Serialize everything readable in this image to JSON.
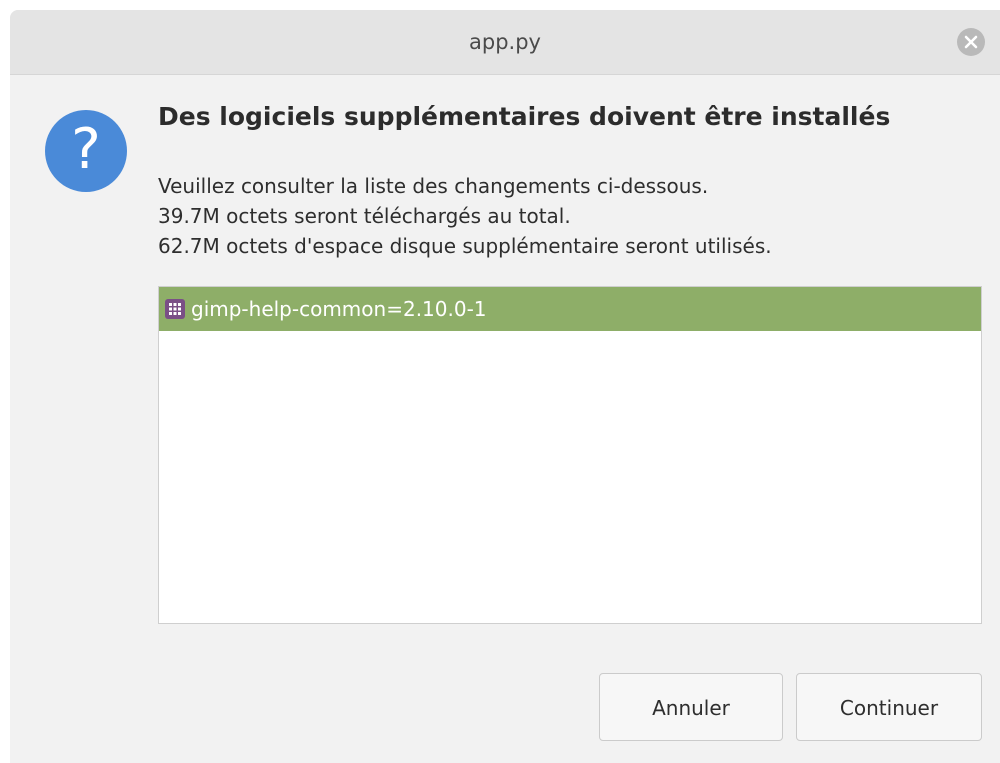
{
  "window": {
    "title": "app.py"
  },
  "dialog": {
    "icon": "question-icon",
    "heading": "Des logiciels supplémentaires doivent être installés",
    "lines": [
      "Veuillez consulter la liste des changements ci-dessous.",
      "39.7M octets seront téléchargés au total.",
      "62.7M octets d'espace disque supplémentaire seront utilisés."
    ]
  },
  "packages": {
    "items": [
      {
        "label": "gimp-help-common=2.10.0-1",
        "icon": "package-icon",
        "selected": true
      }
    ]
  },
  "buttons": {
    "cancel_label": "Annuler",
    "continue_label": "Continuer"
  },
  "colors": {
    "accent_selection": "#8eae68",
    "question_icon": "#4a8ad8",
    "package_icon": "#7a4f86"
  }
}
